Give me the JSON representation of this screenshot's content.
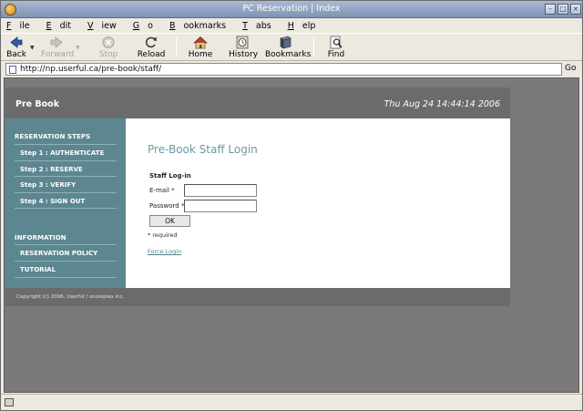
{
  "window": {
    "title": "PC Reservation | Index"
  },
  "menu": [
    {
      "label": "File",
      "key": "F",
      "rest": "ile"
    },
    {
      "label": "Edit",
      "key": "E",
      "rest": "dit"
    },
    {
      "label": "View",
      "key": "V",
      "rest": "iew"
    },
    {
      "label": "Go",
      "key": "G",
      "rest": "o"
    },
    {
      "label": "Bookmarks",
      "key": "B",
      "rest": "ookmarks"
    },
    {
      "label": "Tabs",
      "key": "T",
      "rest": "abs"
    },
    {
      "label": "Help",
      "key": "H",
      "rest": "elp"
    }
  ],
  "toolbar": {
    "back": "Back",
    "forward": "Forward",
    "stop": "Stop",
    "reload": "Reload",
    "home": "Home",
    "history": "History",
    "bookmarks": "Bookmarks",
    "find": "Find"
  },
  "url": {
    "value": "http://np.userful.ca/pre-book/staff/",
    "go": "Go"
  },
  "site": {
    "brand": "Pre Book",
    "date": "Thu Aug 24 14:44:14 2006",
    "sidebar": {
      "reservation_heading": "RESERVATION STEPS",
      "steps": [
        "Step 1 : AUTHENTICATE",
        "Step 2 : RESERVE",
        "Step 3 : VERIFY",
        "Step 4 : SIGN OUT"
      ],
      "info_heading": "INFORMATION",
      "info_items": [
        "RESERVATION POLICY",
        "TUTORIAL"
      ]
    },
    "main": {
      "title": "Pre-Book Staff Login",
      "form_heading": "Staff Log-in",
      "email_label": "E-mail *",
      "password_label": "Password *",
      "email_value": "",
      "password_value": "",
      "ok_label": "OK",
      "required_note": "* required",
      "force_login": "Force Login"
    },
    "footer": "Copyright (c) 2006, Userful / ocoreplex inc."
  }
}
